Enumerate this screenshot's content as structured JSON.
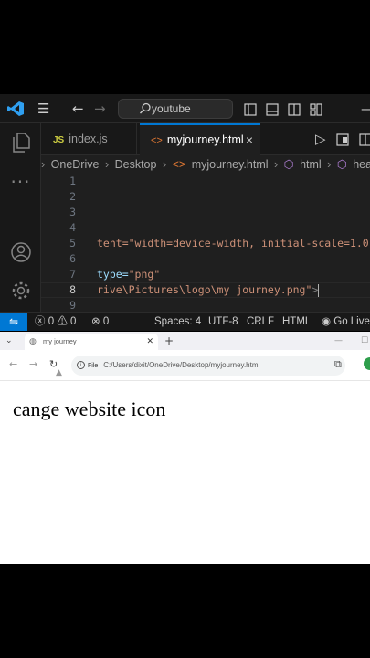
{
  "vscode": {
    "search": "youtube",
    "tabs": [
      {
        "icon": "JS",
        "label": "index.js"
      },
      {
        "icon": "<>",
        "label": "myjourney.html",
        "close": "×"
      }
    ],
    "breadcrumb": [
      "OneDrive",
      "Desktop",
      "myjourney.html",
      "html",
      "head"
    ],
    "line_numbers": [
      "1",
      "2",
      "3",
      "4",
      "5",
      "6",
      "7",
      "8",
      "9"
    ],
    "code": {
      "l5_str": "tent=\"width=device-width, initial-scale=1.0",
      "l7_attr": "type=",
      "l7_str": "\"png\"",
      "l8_str": "rive\\Pictures\\logo\\my journey.png\"",
      "l8_tag": ">"
    },
    "status": {
      "errors": "0",
      "warnings": "0",
      "ports": "0",
      "spaces": "Spaces: 4",
      "encoding": "UTF-8",
      "eol": "CRLF",
      "language": "HTML",
      "live": "Go Live"
    }
  },
  "browser": {
    "tab_title": "my journey",
    "address_scheme": "File",
    "address": "C:/Users/dixit/OneDrive/Desktop/myjourney.html",
    "page_heading": "cange website icon"
  },
  "colors": {
    "vscode_accent": "#0078d4",
    "string": "#ce9178",
    "attribute": "#9cdcfe"
  }
}
